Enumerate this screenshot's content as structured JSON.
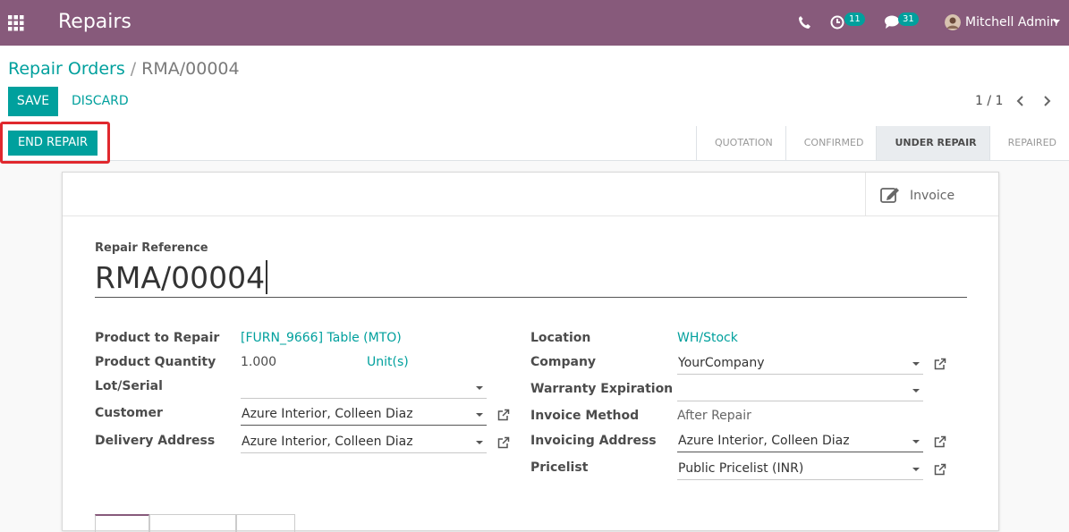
{
  "navbar": {
    "app_title": "Repairs",
    "activity_count": "11",
    "message_count": "31",
    "user_name": "Mitchell Admin"
  },
  "breadcrumb": {
    "parent": "Repair Orders",
    "separator": "/",
    "current": "RMA/00004"
  },
  "toolbar": {
    "save_label": "SAVE",
    "discard_label": "DISCARD",
    "pager": "1 / 1"
  },
  "statusbar": {
    "end_repair_label": "END REPAIR",
    "stages": [
      "QUOTATION",
      "CONFIRMED",
      "UNDER REPAIR",
      "REPAIRED"
    ],
    "active_stage": "UNDER REPAIR"
  },
  "smart_buttons": {
    "invoice_label": "Invoice"
  },
  "form": {
    "ref_label": "Repair Reference",
    "ref_value": "RMA/00004",
    "left": {
      "product_label": "Product to Repair",
      "product_value": "[FURN_9666] Table (MTO)",
      "qty_label": "Product Quantity",
      "qty_value": "1.000",
      "uom_value": "Unit(s)",
      "lot_label": "Lot/Serial",
      "lot_value": "",
      "customer_label": "Customer",
      "customer_value": "Azure Interior, Colleen Diaz",
      "delivery_label": "Delivery Address",
      "delivery_value": "Azure Interior, Colleen Diaz"
    },
    "right": {
      "location_label": "Location",
      "location_value": "WH/Stock",
      "company_label": "Company",
      "company_value": "YourCompany",
      "warranty_label": "Warranty Expiration",
      "warranty_value": "",
      "invoice_method_label": "Invoice Method",
      "invoice_method_value": "After Repair",
      "invoicing_address_label": "Invoicing Address",
      "invoicing_address_value": "Azure Interior, Colleen Diaz",
      "pricelist_label": "Pricelist",
      "pricelist_value": "Public Pricelist (INR)"
    }
  },
  "colors": {
    "navbar": "#875a7b",
    "primary": "#00a09d",
    "highlight": "#e0282e"
  }
}
